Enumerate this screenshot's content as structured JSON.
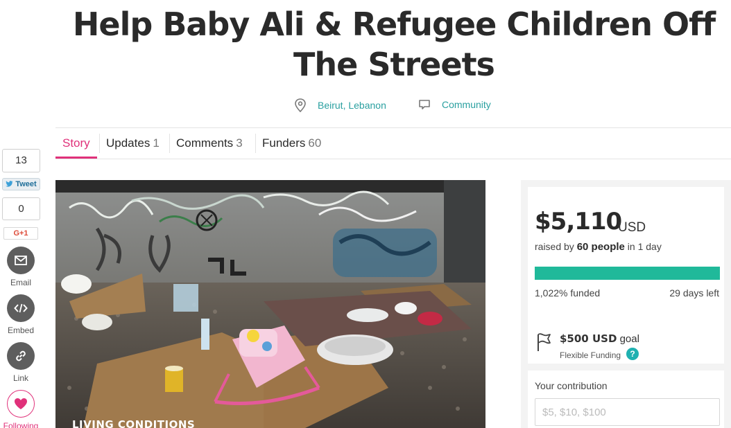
{
  "campaign": {
    "title": "Help Baby Ali & Refugee Children Off The Streets",
    "location": "Beirut, Lebanon",
    "category": "Community"
  },
  "tabs": [
    {
      "label": "Story",
      "count": ""
    },
    {
      "label": "Updates",
      "count": "1"
    },
    {
      "label": "Comments",
      "count": "3"
    },
    {
      "label": "Funders",
      "count": "60"
    }
  ],
  "share": {
    "tweet_count": "13",
    "tweet_label": "Tweet",
    "gplus_count": "0",
    "gplus_label": "G+1",
    "email_label": "Email",
    "embed_label": "Embed",
    "link_label": "Link",
    "following_label": "Following"
  },
  "photo": {
    "caption": "LIVING CONDITIONS"
  },
  "funding": {
    "amount": "$5,110",
    "currency": "USD",
    "raised_prefix": "raised by",
    "people": "60 people",
    "raised_suffix": "in 1 day",
    "progress_fraction": 1.0,
    "funded_text": "1,022% funded",
    "days_left": "29 days left",
    "goal_amount": "$500 USD",
    "goal_word": "goal",
    "funding_type": "Flexible Funding",
    "help_icon": "?"
  },
  "contribution": {
    "label": "Your contribution",
    "placeholder": "$5, $10, $100"
  },
  "colors": {
    "accent": "#e0317a",
    "teal": "#20b99a",
    "link": "#2aa0a0"
  }
}
